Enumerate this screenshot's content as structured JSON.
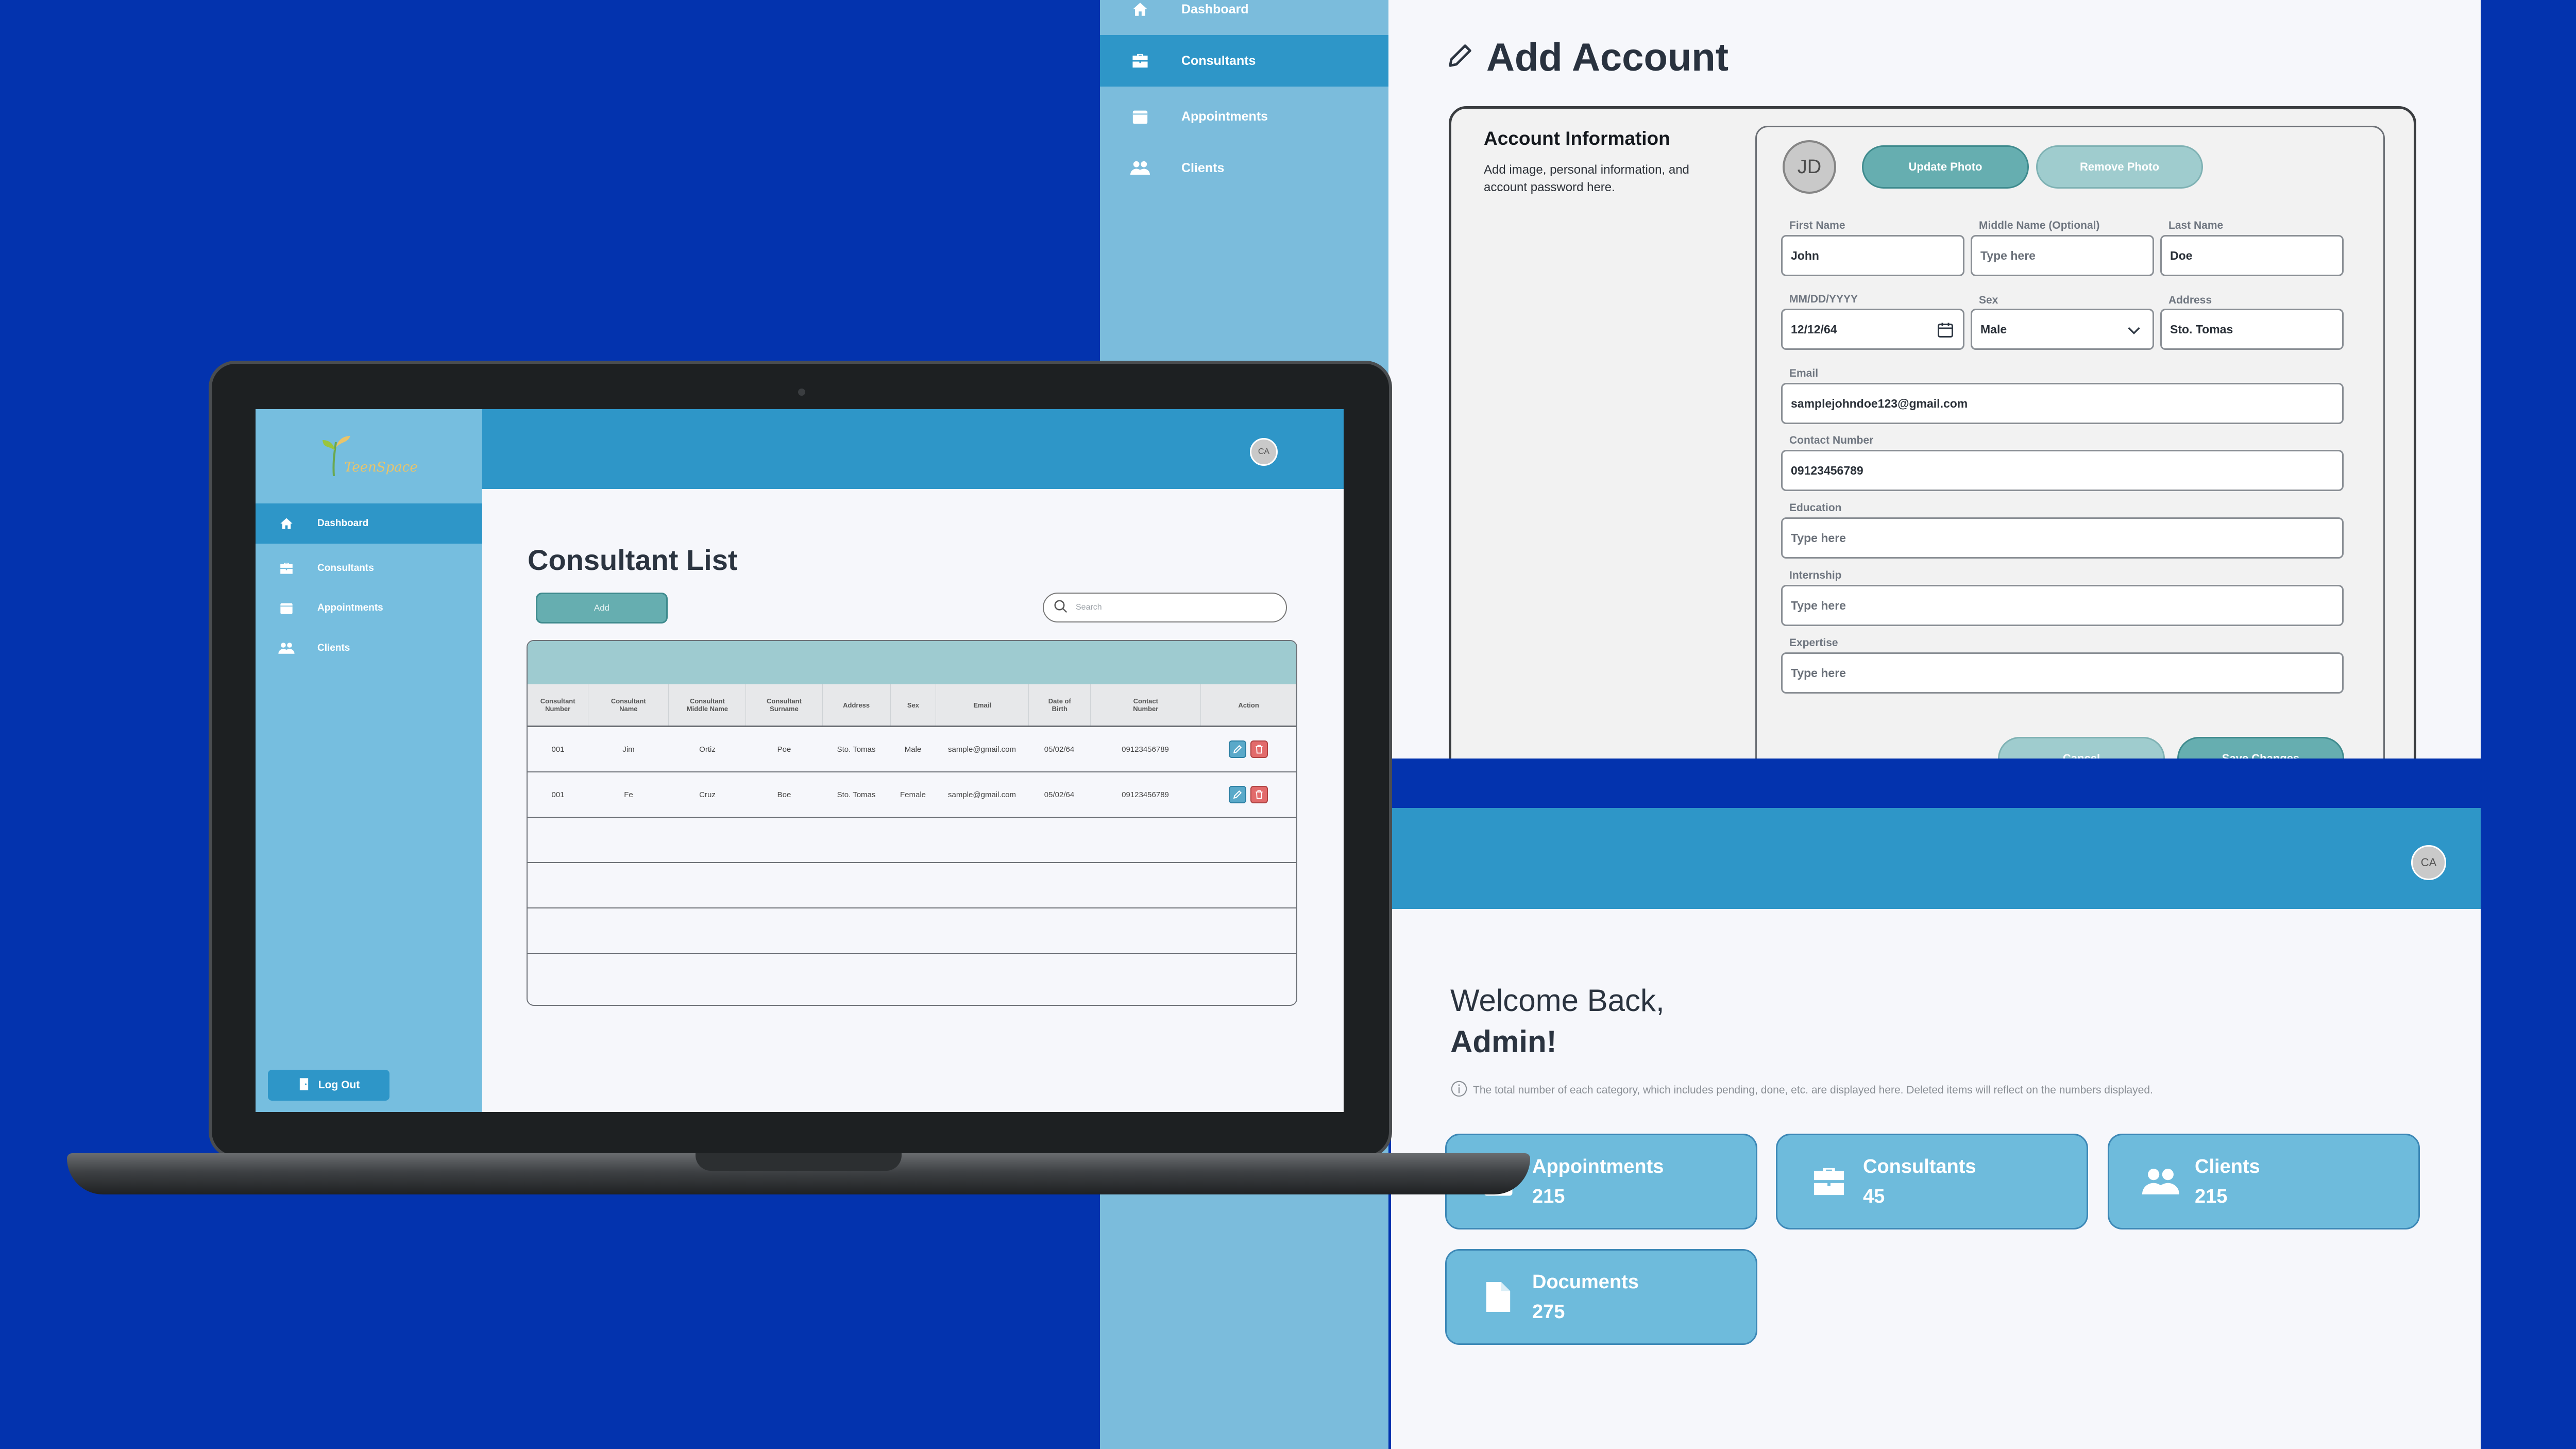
{
  "right_sidebar": {
    "items": [
      {
        "label": "Dashboard",
        "icon": "home-icon"
      },
      {
        "label": "Consultants",
        "icon": "briefcase-icon",
        "active": true
      },
      {
        "label": "Appointments",
        "icon": "calendar-icon"
      },
      {
        "label": "Clients",
        "icon": "users-icon"
      }
    ]
  },
  "add_account": {
    "title": "Add Account",
    "section_title": "Account Information",
    "section_desc": "Add image, personal information, and account password here.",
    "avatar_initials": "JD",
    "update_photo": "Update Photo",
    "remove_photo": "Remove Photo",
    "fields": {
      "first_name": {
        "label": "First Name",
        "value": "John"
      },
      "middle_name": {
        "label": "Middle Name (Optional)",
        "placeholder": "Type here"
      },
      "last_name": {
        "label": "Last Name",
        "value": "Doe"
      },
      "dob": {
        "label": "MM/DD/YYYY",
        "value": "12/12/64"
      },
      "sex": {
        "label": "Sex",
        "value": "Male"
      },
      "address": {
        "label": "Address",
        "value": "Sto. Tomas"
      },
      "email": {
        "label": "Email",
        "value": "samplejohndoe123@gmail.com"
      },
      "contact": {
        "label": "Contact Number",
        "value": "09123456789"
      },
      "education": {
        "label": "Education",
        "placeholder": "Type here"
      },
      "internship": {
        "label": "Internship",
        "placeholder": "Type here"
      },
      "expertise": {
        "label": "Expertise",
        "placeholder": "Type here"
      }
    },
    "cancel": "Cancel",
    "save": "Save Changes"
  },
  "dashboard": {
    "avatar": "CA",
    "welcome_line1": "Welcome Back,",
    "welcome_line2": "Admin!",
    "info_note": "The total number of each category, which includes pending, done, etc. are displayed here. Deleted items will reflect on the numbers displayed.",
    "stats": [
      {
        "label": "Appointments",
        "value": "215",
        "icon": "calendar-icon"
      },
      {
        "label": "Consultants",
        "value": "45",
        "icon": "briefcase-icon"
      },
      {
        "label": "Clients",
        "value": "215",
        "icon": "users-icon"
      },
      {
        "label": "Documents",
        "value": "275",
        "icon": "document-icon"
      }
    ]
  },
  "laptop": {
    "logo_text": "TeenSpace",
    "sidebar": [
      {
        "label": "Dashboard",
        "icon": "home-icon",
        "active": true
      },
      {
        "label": "Consultants",
        "icon": "briefcase-icon"
      },
      {
        "label": "Appointments",
        "icon": "calendar-icon"
      },
      {
        "label": "Clients",
        "icon": "users-icon"
      }
    ],
    "logout": "Log Out",
    "avatar": "CA",
    "page_title": "Consultant List",
    "add_button": "Add",
    "search_placeholder": "Search",
    "columns": [
      [
        "Consultant",
        "Number"
      ],
      [
        "Consultant",
        "Name"
      ],
      [
        "Consultant",
        "Middle Name"
      ],
      [
        "Consultant",
        "Surname"
      ],
      [
        "Address",
        ""
      ],
      [
        "Sex",
        ""
      ],
      [
        "Email",
        ""
      ],
      [
        "Date of",
        "Birth"
      ],
      [
        "Contact",
        "Number"
      ],
      [
        "Action",
        ""
      ]
    ],
    "rows": [
      [
        "001",
        "Jim",
        "Ortiz",
        "Poe",
        "Sto. Tomas",
        "Male",
        "sample@gmail.com",
        "05/02/64",
        "09123456789"
      ],
      [
        "001",
        "Fe",
        "Cruz",
        "Boe",
        "Sto. Tomas",
        "Female",
        "sample@gmail.com",
        "05/02/64",
        "09123456789"
      ]
    ]
  },
  "colors": {
    "background": "#0333ae",
    "sidebar": "#76bedf",
    "header": "#2e96c8",
    "teal_button": "#66aeb0",
    "stat_card": "#6ebbdc"
  }
}
